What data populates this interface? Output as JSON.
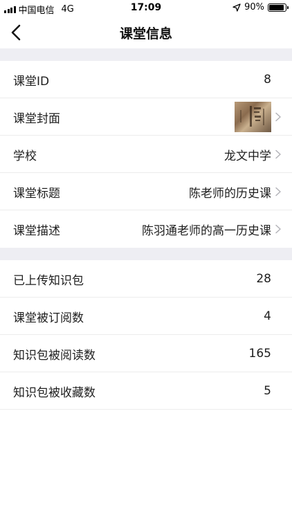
{
  "status_bar": {
    "carrier": "中国电信",
    "network": "4G",
    "time": "17:09",
    "battery": "90%",
    "battery_level": 0.9
  },
  "nav": {
    "title": "课堂信息"
  },
  "section1": [
    {
      "label": "课堂ID",
      "value": "8",
      "has_chevron": false
    },
    {
      "label": "课堂封面",
      "value": "",
      "has_chevron": true,
      "thumbnail": true
    },
    {
      "label": "学校",
      "value": "龙文中学",
      "has_chevron": true
    },
    {
      "label": "课堂标题",
      "value": "陈老师的历史课",
      "has_chevron": true
    },
    {
      "label": "课堂描述",
      "value": "陈羽通老师的高一历史课",
      "has_chevron": true
    }
  ],
  "section2": [
    {
      "label": "已上传知识包",
      "value": "28"
    },
    {
      "label": "课堂被订阅数",
      "value": "4"
    },
    {
      "label": "知识包被阅读数",
      "value": "165"
    },
    {
      "label": "知识包被收藏数",
      "value": "5"
    }
  ],
  "colors": {
    "section_gap": "#eeeef3",
    "divider": "#ececec",
    "chevron": "#b3b3b8"
  }
}
